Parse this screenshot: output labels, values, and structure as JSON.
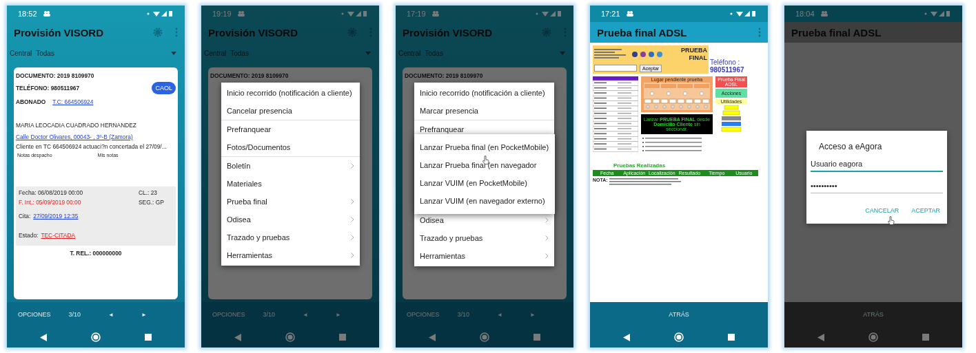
{
  "phones": [
    {
      "kind": "detail",
      "dimmed": false,
      "status_time": "18:52",
      "title": "Provisión VISORD",
      "settings_button": true,
      "overflow_menu": true,
      "filter": {
        "label": "Central",
        "value": "Todas"
      },
      "card": {
        "document": "DOCUMENTO: 2019 8109970",
        "phone": "TELÉFONO: 980511967",
        "badge": "CAOL",
        "subscriber_label": "ABONADO",
        "subscriber_link": "T.C: 664506924",
        "name": "MARIA LEOCADIA CUADRADO HERNANDEZ",
        "address": "Calle  Doctor Olivares, 00043-  , 3º-B (Zamora)",
        "note": "Cliente  en TC 664506924 actuaci?n concertada el 27/09/...",
        "notes_tabs": [
          "Notas despacho",
          "Mis notas"
        ],
        "dates": {
          "fecha": "Fecha: 06/08/2019 00:00",
          "cl": "CL.: 23",
          "f_int": "F. Int.: 05/09/2019 00:00",
          "seg": "SEG.: GP",
          "cita_label": "Cita:",
          "cita": "27/09/2019 12:35",
          "estado_label": "Estado:",
          "estado": "TEC-CITADA"
        },
        "rel": "T. REL.: 000000000"
      },
      "bottom_bar": {
        "kind": "pager",
        "options": "OPCIONES",
        "page": "3/10",
        "prev": "◄",
        "next": "►"
      }
    },
    {
      "kind": "menu",
      "dimmed": true,
      "status_time": "19:19",
      "title": "Provisión VISORD",
      "settings_button": true,
      "overflow_menu": true,
      "filter": {
        "label": "Central",
        "value": "Todas"
      },
      "card": {
        "document": "DOCUMENTO: 2019 8109970"
      },
      "menu": [
        {
          "kind": "item",
          "label": "Inicio recorrido (notificación a cliente)",
          "has_submenu": false,
          "divider_after": false
        },
        {
          "kind": "item",
          "label": "Cancelar presencia",
          "has_submenu": false,
          "divider_after": true
        },
        {
          "kind": "item",
          "label": "Prefranquear",
          "has_submenu": false,
          "divider_after": false
        },
        {
          "kind": "item",
          "label": "Fotos/Documentos",
          "has_submenu": false,
          "divider_after": true
        },
        {
          "kind": "item",
          "label": "Boletín",
          "has_submenu": true,
          "divider_after": false
        },
        {
          "kind": "item",
          "label": "Materiales",
          "has_submenu": false,
          "divider_after": false
        },
        {
          "kind": "item",
          "label": "Prueba final",
          "has_submenu": true,
          "divider_after": false
        },
        {
          "kind": "item",
          "label": "Odisea",
          "has_submenu": true,
          "divider_after": false
        },
        {
          "kind": "item",
          "label": "Trazado y pruebas",
          "has_submenu": true,
          "divider_after": false
        },
        {
          "kind": "item",
          "label": "Herramientas",
          "has_submenu": true,
          "divider_after": false
        }
      ],
      "bottom_bar": {
        "kind": "pager",
        "options": "OPCIONES",
        "page": "3/10",
        "prev": "◄",
        "next": "►"
      }
    },
    {
      "kind": "menu",
      "dimmed": true,
      "status_time": "17:19",
      "title": "Provisión VISORD",
      "settings_button": true,
      "overflow_menu": true,
      "filter": {
        "label": "Central",
        "value": "Todas"
      },
      "card": {
        "document": "DOCUMENTO: 2019 8109970"
      },
      "menu": [
        {
          "kind": "item",
          "label": "Inicio recorrido (notificación a cliente)",
          "has_submenu": false,
          "divider_after": false
        },
        {
          "kind": "item",
          "label": "Marcar presencia",
          "has_submenu": false,
          "divider_after": true
        },
        {
          "kind": "item",
          "label": "Prefranquear",
          "has_submenu": false,
          "divider_after": false
        },
        {
          "kind": "popup",
          "items": [
            "Lanzar Prueba final (en PocketMobile)",
            "Lanzar Prueba final (en navegador",
            "Lanzar VUIM (en PocketMobile)",
            "Lanzar VUIM (en navegador externo)"
          ]
        },
        {
          "kind": "item",
          "label": "Odisea",
          "has_submenu": true,
          "divider_after": false
        },
        {
          "kind": "item",
          "label": "Trazado y pruebas",
          "has_submenu": true,
          "divider_after": false
        },
        {
          "kind": "item",
          "label": "Herramientas",
          "has_submenu": true,
          "divider_after": false
        }
      ],
      "bottom_bar": {
        "kind": "pager",
        "options": "OPCIONES",
        "page": "3/10",
        "prev": "◄",
        "next": "►"
      }
    },
    {
      "kind": "web",
      "dimmed": false,
      "status_time": "17:21",
      "title": "Prueba final ADSL",
      "settings_button": false,
      "overflow_menu": true,
      "web": {
        "heading": "PRUEBA FINAL",
        "phone_label": "Teléfono :",
        "phone_number": "980511967",
        "accept_button": "Aceptar",
        "pending_title": "Lugar pendiente prueba",
        "launch_text": "Lanzar **PRUEBA FINAL** desde **Domicilio Cliente** sin seccionar.",
        "side_title": "Prueba Final ADSL",
        "actions_title": "Acciones",
        "utilities_title": "Utilidades",
        "results_title": "Pruebas Realizadas",
        "results_columns": [
          "Fecha",
          "Aplicación",
          "Localización",
          "Resultado",
          "Tiempo",
          "Usuario"
        ],
        "note_label": "NOTA:"
      },
      "bottom_bar": {
        "kind": "back",
        "label": "ATRÁS"
      }
    },
    {
      "kind": "dialog",
      "dimmed": true,
      "status_time": "18:04",
      "title": "Prueba final ADSL",
      "settings_button": false,
      "overflow_menu": false,
      "dialog": {
        "title": "Acceso a eAgora",
        "fields": [
          {
            "value": "Usuario eagora",
            "focused": true
          },
          {
            "value": "••••••••••",
            "focused": false
          }
        ],
        "buttons": [
          "CANCELAR",
          "ACEPTAR"
        ]
      },
      "bottom_bar": {
        "kind": "back",
        "label": "ATRÁS"
      }
    }
  ]
}
